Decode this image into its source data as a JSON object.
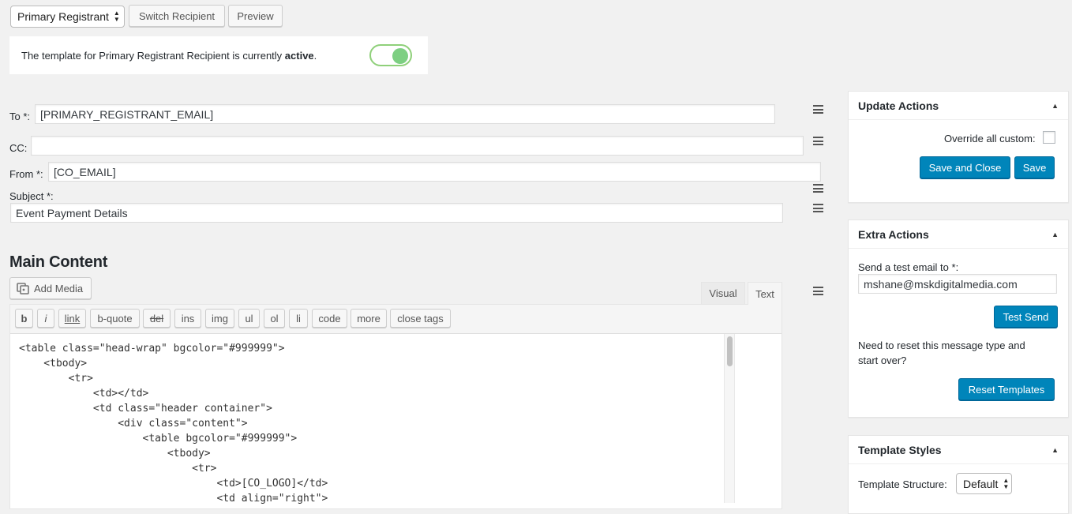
{
  "toolbar": {
    "recipient_select": "Primary Registrant",
    "switch_label": "Switch Recipient",
    "preview_label": "Preview"
  },
  "notice": {
    "text_before": "The template for Primary Registrant Recipient is currently ",
    "status": "active",
    "text_after": ".",
    "toggle_on": true
  },
  "fields": {
    "to_label": "To *:",
    "to_value": "[PRIMARY_REGISTRANT_EMAIL]",
    "cc_label": "CC:",
    "cc_value": "",
    "from_label": "From *:",
    "from_value": "[CO_EMAIL]",
    "subject_label": "Subject *:",
    "subject_value": "Event Payment Details"
  },
  "main_content": {
    "heading": "Main Content",
    "add_media_label": "Add Media",
    "tabs": [
      "Visual",
      "Text"
    ],
    "active_tab": "Text",
    "quicktags": [
      "b",
      "i",
      "link",
      "b-quote",
      "del",
      "ins",
      "img",
      "ul",
      "ol",
      "li",
      "code",
      "more",
      "close tags"
    ],
    "code_lines": [
      "<table class=\"head-wrap\" bgcolor=\"#999999\">",
      "    <tbody>",
      "        <tr>",
      "            <td></td>",
      "            <td class=\"header container\">",
      "                <div class=\"content\">",
      "                    <table bgcolor=\"#999999\">",
      "                        <tbody>",
      "                            <tr>",
      "                                <td>[CO_LOGO]</td>",
      "                                <td align=\"right\">"
    ]
  },
  "update_actions": {
    "title": "Update Actions",
    "override_label": "Override all custom:",
    "save_close_label": "Save and Close",
    "save_label": "Save"
  },
  "extra_actions": {
    "title": "Extra Actions",
    "test_email_label": "Send a test email to *:",
    "test_email_value": "mshane@mskdigitalmedia.com",
    "test_send_label": "Test Send",
    "reset_text": "Need to reset this message type and start over?",
    "reset_label": "Reset Templates"
  },
  "template_styles": {
    "title": "Template Styles",
    "structure_label": "Template Structure:",
    "structure_value": "Default"
  },
  "colors": {
    "primary": "#0085ba",
    "toggle_on": "#7ad03a",
    "background": "#f1f1f1"
  }
}
